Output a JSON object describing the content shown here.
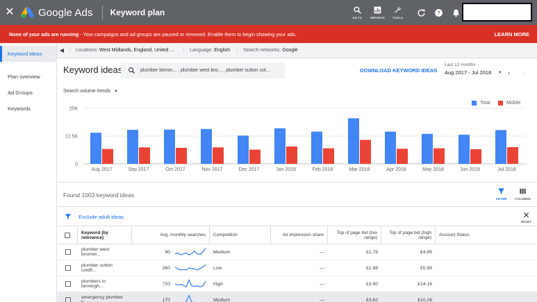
{
  "topbar": {
    "logo_text": "Google Ads",
    "page_title": "Keyword plan",
    "tools": [
      {
        "label": "GO TO",
        "icon": "search-icon"
      },
      {
        "label": "REPORTS",
        "icon": "bar-chart-icon"
      },
      {
        "label": "TOOLS",
        "icon": "wrench-icon"
      }
    ],
    "icons": [
      "refresh-icon",
      "help-icon",
      "notifications-icon"
    ]
  },
  "alert": {
    "bold": "None of your ads are running",
    "text": " - Your campaigns and ad groups are paused or removed. Enable them to begin showing your ads.",
    "action": "LEARN MORE"
  },
  "sidebar": {
    "items": [
      "Keyword ideas",
      "Plan overview",
      "Ad Groups",
      "Keywords"
    ]
  },
  "filters": {
    "locations_label": "Locations:",
    "locations_value": "West Midlands, England, United ...",
    "language_label": "Language:",
    "language_value": "English",
    "networks_label": "Search networks:",
    "networks_value": "Google"
  },
  "header": {
    "title": "Keyword ideas",
    "search_value": "plumber birmin...  , plumber west bro...  , plumber sutton col...",
    "download": "DOWNLOAD KEYWORD IDEAS",
    "date_label": "Last 12 months",
    "date_value": "Aug 2017 - Jul 2018"
  },
  "chart_data": {
    "type": "bar",
    "control": "Search volume trends",
    "categories": [
      "Aug 2017",
      "Sep 2017",
      "Oct 2017",
      "Nov 2017",
      "Dec 2017",
      "Jan 2018",
      "Feb 2018",
      "Mar 2018",
      "Apr 2018",
      "May 2018",
      "Jun 2018",
      "Jul 2018"
    ],
    "series": [
      {
        "name": "Total",
        "color": "#4285f4",
        "values": [
          14000,
          15300,
          15400,
          15700,
          12700,
          16000,
          14500,
          20500,
          14500,
          13500,
          13100,
          15200
        ]
      },
      {
        "name": "Mobile",
        "color": "#ea4335",
        "values": [
          6700,
          7400,
          7200,
          7400,
          6400,
          7800,
          7000,
          10800,
          6800,
          7000,
          6600,
          7500
        ]
      }
    ],
    "yticks": [
      "25K",
      "12.5K",
      "0"
    ],
    "ylim": [
      0,
      25000
    ],
    "legend_position": "top-right"
  },
  "results": {
    "found": "Found 1003 keyword ideas",
    "filter_label": "FILTER",
    "columns_label": "COLUMNS",
    "exclude": "Exclude adult ideas",
    "reset_label": "RESET"
  },
  "table": {
    "headers": {
      "keyword": "Keyword (by relevance)",
      "avg": "Avg. monthly searches",
      "competition": "Competition",
      "impression": "Ad impression share",
      "low": "Top of page bid (low range)",
      "high": "Top of page bid (high range)",
      "account": "Account Status"
    },
    "rows": [
      {
        "keyword": "plumber west bromwi...",
        "avg": "90",
        "competition": "Medium",
        "impression": "—",
        "low": "£1.78",
        "high": "£4.99",
        "trend": [
          0.3,
          0.4,
          0.2,
          0.3,
          0.4,
          0.2,
          0.35,
          0.6,
          0.3,
          0.25,
          0.5,
          0.9
        ]
      },
      {
        "keyword": "plumber sutton coldfi...",
        "avg": "260",
        "competition": "Low",
        "impression": "—",
        "low": "£1.98",
        "high": "£5.99",
        "trend": [
          0.6,
          0.4,
          0.3,
          0.35,
          0.3,
          0.5,
          0.45,
          0.4,
          0.3,
          0.45,
          0.6,
          0.85
        ]
      },
      {
        "keyword": "plumbers in birmingh...",
        "avg": "720",
        "competition": "High",
        "impression": "—",
        "low": "£3.90",
        "high": "£14.16",
        "trend": [
          0.5,
          0.4,
          0.45,
          0.35,
          0.2,
          0.9,
          0.3,
          0.25,
          0.3,
          0.2,
          0.3,
          0.8
        ]
      },
      {
        "keyword": "emergency plumber b...",
        "avg": "170",
        "competition": "Medium",
        "impression": "—",
        "low": "£3.62",
        "high": "£10.26",
        "trend": [
          0.2,
          0.2,
          0.25,
          0.2,
          0.3,
          0.95,
          0.3,
          0.2,
          0.2,
          0.25,
          0.2,
          0.2
        ]
      }
    ]
  }
}
